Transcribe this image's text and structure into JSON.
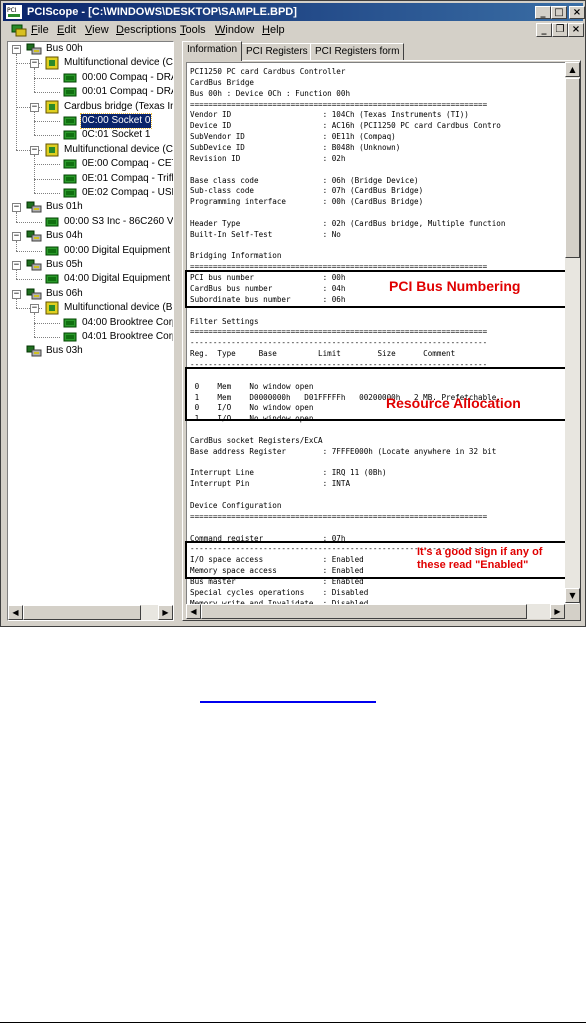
{
  "window": {
    "title": "PCIScope - [C:\\WINDOWS\\DESKTOP\\SAMPLE.BPD]",
    "app_icon_text": "PCI",
    "buttons": {
      "minimize": "_",
      "maximize": "□",
      "close": "×",
      "restore": "❐"
    }
  },
  "menubar": {
    "items": [
      {
        "label": "File",
        "accel": "F",
        "rest": "ile"
      },
      {
        "label": "Edit",
        "accel": "E",
        "rest": "dit"
      },
      {
        "label": "View",
        "accel": "V",
        "rest": "iew"
      },
      {
        "label": "Descriptions",
        "accel": "D",
        "rest": "escriptions"
      },
      {
        "label": "Tools",
        "accel": "T",
        "rest": "ools"
      },
      {
        "label": "Window",
        "accel": "W",
        "rest": "indow"
      },
      {
        "label": "Help",
        "accel": "H",
        "rest": "elp"
      }
    ]
  },
  "tree": {
    "nodes": [
      {
        "label": "Bus 00h",
        "type": "bus",
        "level": 0,
        "expander": "−"
      },
      {
        "label": "Multifunctional device (Co",
        "type": "multi",
        "level": 1,
        "expander": "−"
      },
      {
        "label": "00:00 Compaq - DRA",
        "type": "chip",
        "level": 2
      },
      {
        "label": "00:01 Compaq - DRA",
        "type": "chip",
        "level": 2
      },
      {
        "label": "Cardbus bridge (Texas Ins",
        "type": "multi",
        "level": 1,
        "expander": "−"
      },
      {
        "label": "0C:00 Socket 0",
        "type": "chip",
        "level": 2,
        "selected": true
      },
      {
        "label": "0C:01 Socket 1",
        "type": "chip",
        "level": 2
      },
      {
        "label": "Multifunctional device (Co",
        "type": "multi",
        "level": 1,
        "expander": "−"
      },
      {
        "label": "0E:00 Compaq - CET",
        "type": "chip",
        "level": 2
      },
      {
        "label": "0E:01 Compaq - Trifle",
        "type": "chip",
        "level": 2
      },
      {
        "label": "0E:02 Compaq - USB",
        "type": "chip",
        "level": 2
      },
      {
        "label": "Bus 01h",
        "type": "bus",
        "level": 0,
        "expander": "−"
      },
      {
        "label": "00:00 S3 Inc - 86C260 Vi",
        "type": "chip",
        "level": 1
      },
      {
        "label": "Bus 04h",
        "type": "bus",
        "level": 0,
        "expander": "−"
      },
      {
        "label": "00:00 Digital Equipment C",
        "type": "chip",
        "level": 1
      },
      {
        "label": "Bus 05h",
        "type": "bus",
        "level": 0,
        "expander": "−"
      },
      {
        "label": "04:00 Digital Equipment C",
        "type": "chip",
        "level": 1
      },
      {
        "label": "Bus 06h",
        "type": "bus",
        "level": 0,
        "expander": "−"
      },
      {
        "label": "Multifunctional device (Br",
        "type": "multi",
        "level": 1,
        "expander": "−"
      },
      {
        "label": "04:00 Brooktree Corp",
        "type": "chip",
        "level": 2
      },
      {
        "label": "04:01 Brooktree Corp",
        "type": "chip",
        "level": 2
      },
      {
        "label": "Bus 03h",
        "type": "bus",
        "level": 0
      }
    ]
  },
  "tabs": [
    {
      "label": "Information",
      "active": true
    },
    {
      "label": "PCI Registers",
      "active": false
    },
    {
      "label": "PCI Registers form",
      "active": false
    }
  ],
  "info_lines": [
    "PCI1250 PC card Cardbus Controller",
    "CardBus Bridge",
    "Bus 00h : Device 0Ch : Function 00h",
    "=================================================================",
    "Vendor ID                    : 104Ch (Texas Instruments (TI))",
    "Device ID                    : AC16h (PCI1250 PC card Cardbus Contro",
    "SubVendor ID                 : 0E11h (Compaq)",
    "SubDevice ID                 : B048h (Unknown)",
    "Revision ID                  : 02h",
    "",
    "Base class code              : 06h (Bridge Device)",
    "Sub-class code               : 07h (CardBus Bridge)",
    "Programming interface        : 00h (CardBus Bridge)",
    "",
    "Header Type                  : 02h (CardBus bridge, Multiple function",
    "Built-In Self-Test           : No",
    "",
    "Bridging Information",
    "=================================================================",
    "PCI bus number               : 00h",
    "CardBus bus number           : 04h",
    "Subordinate bus number       : 06h",
    "",
    "Filter Settings",
    "=================================================================",
    "-----------------------------------------------------------------",
    "Reg.  Type     Base         Limit        Size      Comment",
    "-----------------------------------------------------------------",
    "",
    " 0    Mem    No window open",
    " 1    Mem    D0000000h   D01FFFFFh   00200000h   2 MB. Prefetchable.",
    " 0    I/O    No window open",
    " 1    I/O    No window open",
    "",
    "CardBus socket Registers/ExCA",
    "Base address Register        : 7FFFE000h (Locate anywhere in 32 bit",
    "",
    "Interrupt Line               : IRQ 11 (0Bh)",
    "Interrupt Pin                : INTA",
    "",
    "Device Configuration",
    "=================================================================",
    "",
    "Command register             : 07h",
    "-----------------------------------------------------------------",
    "I/O space access             : Enabled",
    "Memory space access          : Enabled",
    "Bus master                   : Enabled",
    "Special cycles operations    : Disabled",
    "Memory write and Invalidate  : Disabled"
  ],
  "annotations": {
    "bus_numbering": "PCI Bus Numbering",
    "resource_allocation": "Resource Allocation",
    "enabled_note": "It's a good sign if any of\nthese read \"Enabled\""
  },
  "colors": {
    "titlebar": "#0a246a",
    "selection": "#0a246a",
    "annotation": "#e00000",
    "face": "#d4d0c8"
  }
}
